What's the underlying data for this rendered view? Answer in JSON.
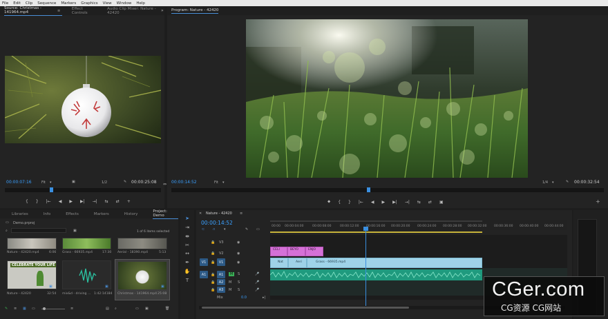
{
  "menu": [
    "File",
    "Edit",
    "Clip",
    "Sequence",
    "Markers",
    "Graphics",
    "View",
    "Window",
    "Help"
  ],
  "source_panel": {
    "tabs": [
      "Source: Christmas - 141964.mp4",
      "Effect Controls",
      "Audio Clip Mixer: Nature - 42420"
    ],
    "timecode_in": "00:00:07:16",
    "fit": "Fit",
    "fraction": "1/2",
    "timecode_out": "00:00:25:08"
  },
  "program_panel": {
    "tab": "Program: Nature - 42420",
    "timecode_in": "00:00:14:52",
    "fit": "Fit",
    "fraction": "1/4",
    "timecode_out": "00:00:32:54"
  },
  "transport_glyphs": [
    "{",
    "}",
    "|←",
    "◀",
    "▶",
    "▶|",
    "→|",
    "⇆",
    "⇄",
    "+"
  ],
  "program_transport_glyphs": [
    "⬥",
    "{",
    "}",
    "|←",
    "◀",
    "▶",
    "▶|",
    "→|",
    "⇆",
    "⇄",
    "▣",
    "+"
  ],
  "project_panel": {
    "tabs": [
      "Libraries",
      "Info",
      "Effects",
      "Markers",
      "History",
      "Project: Demo"
    ],
    "file": "Demo.prproj",
    "items_selected": "1 of 6 items selected",
    "items": [
      {
        "name": "Nature - 42420.mp4",
        "duration": "6:06"
      },
      {
        "name": "Grass - 66935.mp4",
        "duration": "17:30"
      },
      {
        "name": "Aerial - 18390.mp4",
        "duration": "5:13"
      },
      {
        "name": "Nature - 42420",
        "duration": "32:54"
      },
      {
        "name": "mix&d - driving ...",
        "duration": "1:42:14184"
      },
      {
        "name": "Christmas - 141964.mp4",
        "duration": "25:08"
      }
    ],
    "thumb_text": "CELEBRATE YOUR LIFE"
  },
  "timeline": {
    "tab": "Nature - 42420",
    "timecode": "00:00:14:52",
    "ruler": [
      "00:00",
      "00:00:04:00",
      "00:00:08:00",
      "00:00:12:00",
      "00:00:16:00",
      "00:00:20:00",
      "00:00:24:00",
      "00:00:28:00",
      "00:00:32:00",
      "00:00:36:00",
      "00:00:40:00",
      "00:00:44:00"
    ],
    "tracks": {
      "v3": "V3",
      "v2": "V2",
      "v1": "V1",
      "a1": "A1",
      "a2": "A2",
      "a3": "A3",
      "mix": "Mix",
      "mix_val": "0.0"
    },
    "targets": {
      "v1": "V1",
      "a1": "A1"
    },
    "pink_clips": [
      "CELI",
      "BEYO",
      "ENJO"
    ],
    "blue_clips": [
      "Nat",
      "Aeri",
      "Grass - 66935.mp4"
    ],
    "track_letters": {
      "m": "M",
      "s": "S"
    }
  },
  "watermark": {
    "main": "CGer.com",
    "sub": "CG资源 CG网站"
  }
}
